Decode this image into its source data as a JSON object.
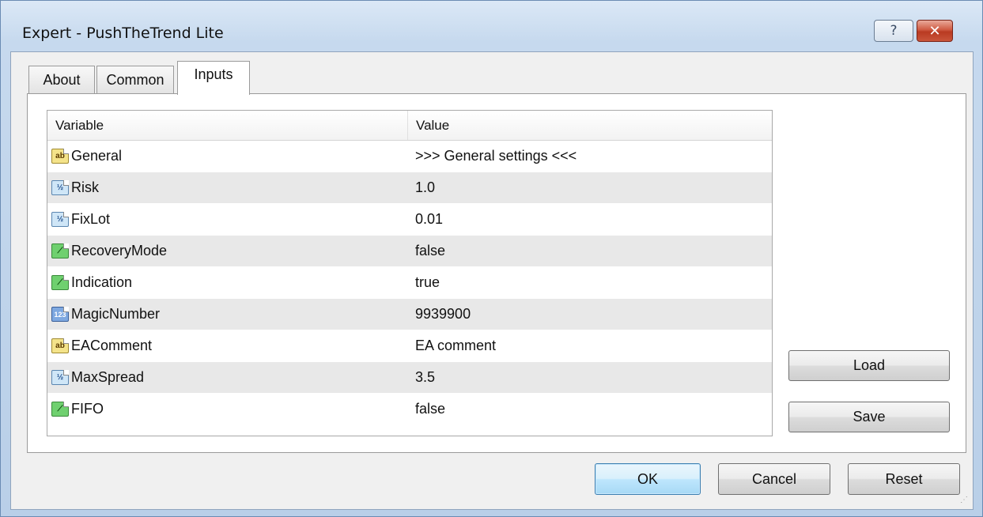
{
  "window": {
    "title": "Expert - PushTheTrend Lite",
    "help_label": "?",
    "close_label": "✕"
  },
  "tabs": [
    {
      "label": "About",
      "active": false
    },
    {
      "label": "Common",
      "active": false
    },
    {
      "label": "Inputs",
      "active": true
    }
  ],
  "grid": {
    "headers": {
      "variable": "Variable",
      "value": "Value"
    },
    "rows": [
      {
        "type_icon": "string-type-icon",
        "icon_text": "ab",
        "variable": "General",
        "value": ">>> General settings <<<"
      },
      {
        "type_icon": "double-type-icon",
        "icon_text": "½",
        "variable": "Risk",
        "value": "1.0"
      },
      {
        "type_icon": "double-type-icon",
        "icon_text": "½",
        "variable": "FixLot",
        "value": "0.01"
      },
      {
        "type_icon": "bool-type-icon",
        "icon_text": "⟋",
        "variable": "RecoveryMode",
        "value": "false"
      },
      {
        "type_icon": "bool-type-icon",
        "icon_text": "⟋",
        "variable": "Indication",
        "value": "true"
      },
      {
        "type_icon": "int-type-icon",
        "icon_text": "123",
        "variable": "MagicNumber",
        "value": "9939900"
      },
      {
        "type_icon": "string-type-icon",
        "icon_text": "ab",
        "variable": "EAComment",
        "value": "EA comment"
      },
      {
        "type_icon": "double-type-icon",
        "icon_text": "½",
        "variable": "MaxSpread",
        "value": "3.5"
      },
      {
        "type_icon": "bool-type-icon",
        "icon_text": "⟋",
        "variable": "FIFO",
        "value": "false"
      }
    ]
  },
  "side_buttons": {
    "load": "Load",
    "save": "Save"
  },
  "footer_buttons": {
    "ok": "OK",
    "cancel": "Cancel",
    "reset": "Reset"
  }
}
